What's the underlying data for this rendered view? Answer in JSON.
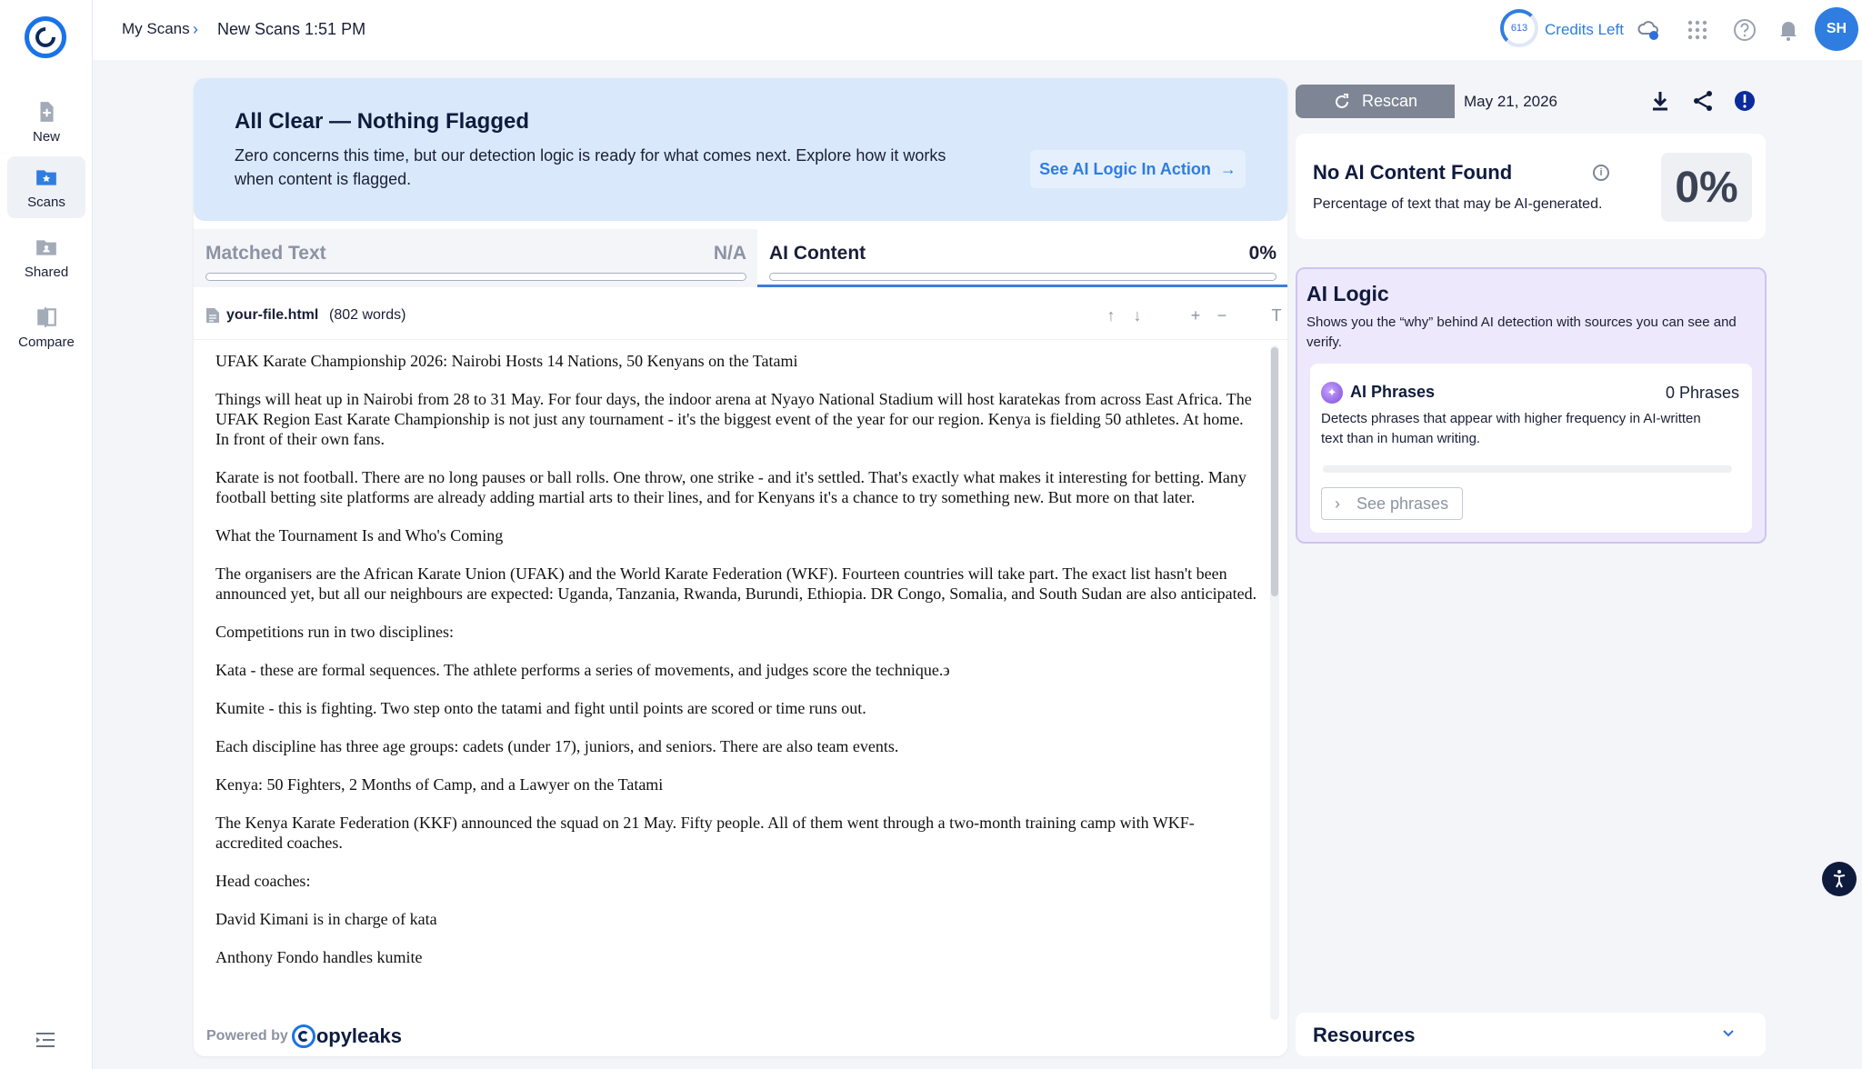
{
  "sidebar": {
    "items": [
      {
        "label": "New",
        "icon": "new-file-icon"
      },
      {
        "label": "Scans",
        "icon": "scans-folder-icon",
        "active": true
      },
      {
        "label": "Shared",
        "icon": "shared-folder-icon"
      },
      {
        "label": "Compare",
        "icon": "compare-icon"
      }
    ]
  },
  "topbar": {
    "breadcrumb": [
      "My Scans",
      "New Scans 1:51 PM"
    ],
    "credits_count": "613",
    "credits_label": "Credits Left",
    "avatar_initials": "SH"
  },
  "banner": {
    "title": "All Clear — Nothing Flagged",
    "text": "Zero concerns this time, but our detection logic is ready for what comes next. Explore how it works when content is flagged.",
    "button_label": "See AI Logic In Action"
  },
  "tabs": [
    {
      "label": "Matched Text",
      "value": "N/A",
      "active": false
    },
    {
      "label": "AI Content",
      "value": "0%",
      "active": true
    }
  ],
  "file": {
    "name": "your-file.html",
    "words": "(802 words)"
  },
  "document": {
    "paragraphs": [
      "UFAK Karate Championship 2026: Nairobi Hosts 14 Nations, 50 Kenyans on the Tatami",
      "Things will heat up in Nairobi from 28 to 31 May. For four days, the indoor arena at Nyayo National Stadium will host karatekas from across East Africa. The UFAK Region East Karate Championship is not just any tournament - it's the biggest event of the year for our region. Kenya is fielding 50 athletes. At home. In front of their own fans.",
      "Karate is not football. There are no long pauses or ball rolls. One throw, one strike - and it's settled. That's exactly what makes it interesting for betting. Many football betting site platforms are already adding martial arts to their lines, and for Kenyans it's a chance to try something new. But more on that later.",
      "What the Tournament Is and Who's Coming",
      "The organisers are the African Karate Union (UFAK) and the World Karate Federation (WKF). Fourteen countries will take part. The exact list hasn't been announced yet, but all our neighbours are expected: Uganda, Tanzania, Rwanda, Burundi, Ethiopia. DR Congo, Somalia, and South Sudan are also anticipated.",
      "Competitions run in two disciplines:",
      "Kata - these are formal sequences. The athlete performs a series of movements, and judges score the technique.϶",
      "Kumite - this is fighting. Two step onto the tatami and fight until points are scored or time runs out.",
      "Each discipline has three age groups: cadets (under 17), juniors, and seniors. There are also team events.",
      "Kenya: 50 Fighters, 2 Months of Camp, and a Lawyer on the Tatami",
      "The Kenya Karate Federation (KKF) announced the squad on 21 May. Fifty people. All of them went through a two-month training camp with WKF-accredited coaches.",
      "Head coaches:",
      "David Kimani is in charge of kata",
      "Anthony Fondo handles kumite"
    ]
  },
  "powered": {
    "prefix": "Powered by",
    "brand": "opyleaks"
  },
  "right": {
    "rescan_label": "Rescan",
    "date": "May 21, 2026",
    "no_ai": {
      "title": "No AI Content Found",
      "description": "Percentage of text that may be AI-generated.",
      "percent": "0%"
    },
    "ai_logic": {
      "title": "AI Logic",
      "description": "Shows you the “why” behind AI detection with sources you can see and verify.",
      "phrases_title": "AI Phrases",
      "phrases_count": "0 Phrases",
      "phrases_description": "Detects phrases that appear with higher frequency in AI-written text than in human writing.",
      "see_phrases": "See phrases"
    },
    "resources_title": "Resources"
  },
  "colors": {
    "accent": "#2f7de1",
    "banner_bg": "#d9e9fb",
    "logic_bg": "#ede8fb"
  }
}
